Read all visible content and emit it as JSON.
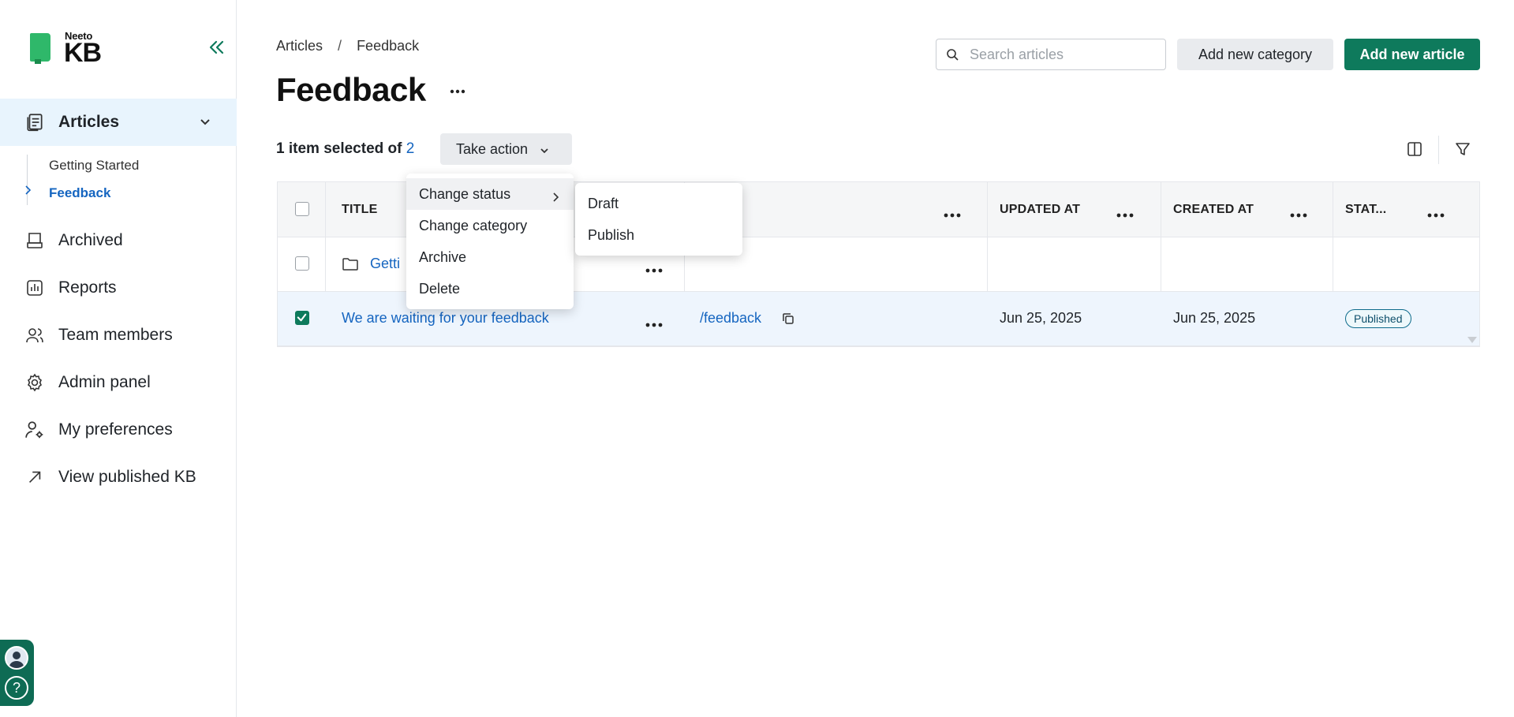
{
  "app": {
    "logo_small": "Neeto",
    "logo_big": "KB"
  },
  "sidebar": {
    "items": [
      {
        "label": "Articles"
      },
      {
        "label": "Archived"
      },
      {
        "label": "Reports"
      },
      {
        "label": "Team members"
      },
      {
        "label": "Admin panel"
      },
      {
        "label": "My preferences"
      },
      {
        "label": "View published KB"
      }
    ],
    "sub_items": [
      {
        "label": "Getting Started"
      },
      {
        "label": "Feedback"
      }
    ]
  },
  "breadcrumb": {
    "root": "Articles",
    "separator": "/",
    "current": "Feedback"
  },
  "page": {
    "title": "Feedback"
  },
  "search": {
    "placeholder": "Search articles"
  },
  "actions": {
    "add_category": "Add new category",
    "add_article": "Add new article",
    "take_action": "Take action"
  },
  "selection": {
    "prefix": "1 item selected of",
    "total": "2"
  },
  "table": {
    "headers": [
      "TITLE",
      "UPDATED AT",
      "CREATED AT",
      "STAT..."
    ],
    "rows": [
      {
        "title": "Getti",
        "slug": "",
        "updated": "",
        "created": "",
        "status": "",
        "type": "category"
      },
      {
        "title": "We are waiting for your feedback",
        "slug": "/feedback",
        "updated": "Jun 25, 2025",
        "created": "Jun 25, 2025",
        "status": "Published",
        "type": "article"
      }
    ]
  },
  "menu": {
    "items": [
      "Change status",
      "Change category",
      "Archive",
      "Delete"
    ],
    "submenu": [
      "Draft",
      "Publish"
    ]
  },
  "colors": {
    "brand": "#0e7a5c",
    "link": "#1565c0",
    "active_bg": "#e8f4fd"
  }
}
